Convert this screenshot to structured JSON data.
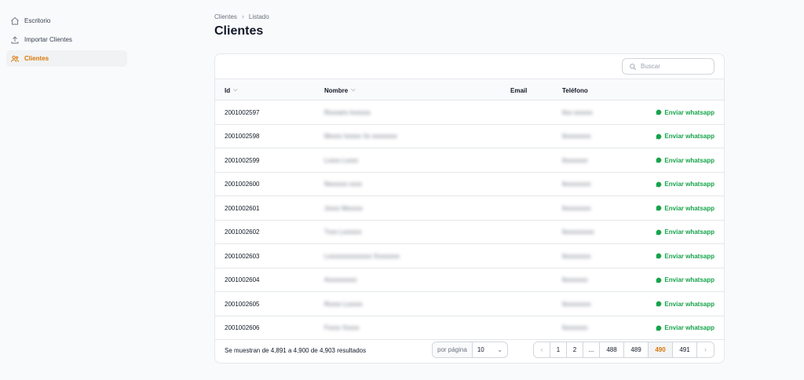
{
  "sidebar": {
    "items": [
      {
        "label": "Escritorio",
        "icon": "home-icon",
        "active": false
      },
      {
        "label": "Importar Clientes",
        "icon": "upload-icon",
        "active": false
      },
      {
        "label": "Clientes",
        "icon": "users-icon",
        "active": true
      }
    ]
  },
  "breadcrumb": {
    "root": "Clientes",
    "current": "Listado"
  },
  "page": {
    "title": "Clientes"
  },
  "search": {
    "placeholder": "Buscar"
  },
  "table": {
    "headers": {
      "id": "Id",
      "nombre": "Nombre",
      "email": "Email",
      "telefono": "Teléfono"
    },
    "action_label": "Enviar whatsapp",
    "rows": [
      {
        "id": "2001002597",
        "nombre": "Rsxxwrs Ivxxxxs",
        "email": "",
        "telefono": "6xx xxxxxx"
      },
      {
        "id": "2001002598",
        "nombre": "Mxxxx Ixxxxx Xx xxxxxxxx",
        "email": "",
        "telefono": "6xxxxxxxx"
      },
      {
        "id": "2001002599",
        "nombre": "Lxxxx Lxxxx",
        "email": "",
        "telefono": "6xxxxxxx"
      },
      {
        "id": "2001002600",
        "nombre": "Nxxxxxx xxxx",
        "email": "",
        "telefono": "6xxxxxxxx"
      },
      {
        "id": "2001002601",
        "nombre": "Jxxxx Mxxxxx",
        "email": "",
        "telefono": "6xxxxxxxx"
      },
      {
        "id": "2001002602",
        "nombre": "Txxx Lxxxxxx",
        "email": "",
        "telefono": "6xxxxxxxxx"
      },
      {
        "id": "2001002603",
        "nombre": "Lxxxxxxxxxxxxxx Xxxxxxxx",
        "email": "",
        "telefono": "6xxxxxxxx"
      },
      {
        "id": "2001002604",
        "nombre": "Axxxxxxxxx",
        "email": "",
        "telefono": "6xxxxxxx"
      },
      {
        "id": "2001002605",
        "nombre": "Rxxxx Lxxxxx",
        "email": "",
        "telefono": "6xxxxxxxx"
      },
      {
        "id": "2001002606",
        "nombre": "Fxxxx Xxxxx",
        "email": "",
        "telefono": "6xxxxxxx"
      }
    ]
  },
  "footer": {
    "results_text": "Se muestran de 4,891 a 4,900 de 4,903 resultados",
    "per_page_label": "por página",
    "per_page_value": "10",
    "pages": [
      "1",
      "2",
      "...",
      "488",
      "489",
      "490",
      "491"
    ],
    "current_page": "490"
  },
  "colors": {
    "accent": "#d97706",
    "whatsapp": "#16a34a"
  }
}
